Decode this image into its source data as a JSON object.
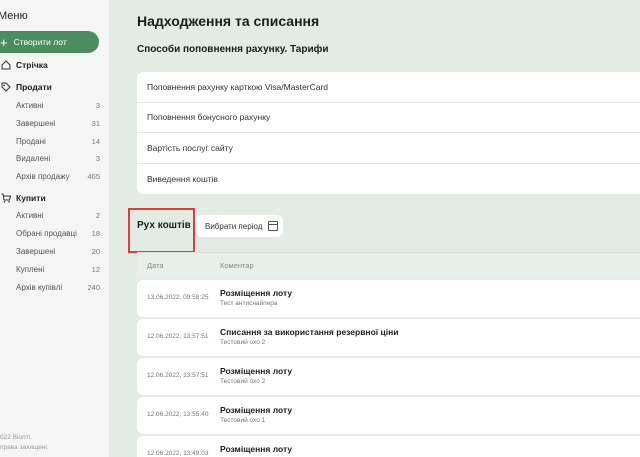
{
  "sidebar": {
    "menu_title": "Меню",
    "create_button": "Створити лот",
    "feed_label": "Стрічка",
    "sell_label": "Продати",
    "sell_items": [
      {
        "label": "Активні",
        "count": "3"
      },
      {
        "label": "Завершені",
        "count": "31"
      },
      {
        "label": "Продані",
        "count": "14"
      },
      {
        "label": "Видалені",
        "count": "3"
      },
      {
        "label": "Архів продажу",
        "count": "465"
      }
    ],
    "buy_label": "Купити",
    "buy_items": [
      {
        "label": "Активні",
        "count": "2"
      },
      {
        "label": "Обрані продавці",
        "count": "18"
      },
      {
        "label": "Завершені",
        "count": "20"
      },
      {
        "label": "Куплені",
        "count": "12"
      },
      {
        "label": "Архів купівлі",
        "count": "240"
      }
    ],
    "copyright_line1": "022 Віолті.",
    "copyright_line2": "права захищені."
  },
  "main": {
    "page_title": "Надходження та списання",
    "methods_title": "Способи поповнення рахунку. Тарифи",
    "links": [
      "Поповнення рахунку карткою Visa/MasterCard",
      "Поповнення бонусного рахунку",
      "Вартість послуг сайту",
      "Виведення коштів"
    ],
    "moves_title": "Рух коштів",
    "period_button": "Вибрати період",
    "table": {
      "col_date": "Дата",
      "col_comment": "Коментар",
      "rows": [
        {
          "date": "13.06.2022, 09:58:25",
          "title": "Розміщення лоту",
          "note": "Тест антиснайпера"
        },
        {
          "date": "12.06.2022, 13:57:51",
          "title": "Списання за використання резервної ціни",
          "note": "Тестовий охо 2"
        },
        {
          "date": "12.06.2022, 13:57:51",
          "title": "Розміщення лоту",
          "note": "Тестовий охо 2"
        },
        {
          "date": "12.06.2022, 13:55:40",
          "title": "Розміщення лоту",
          "note": "Тестовий охо 1"
        },
        {
          "date": "12.06.2022, 13:49:03",
          "title": "Розміщення лоту",
          "note": ""
        }
      ]
    }
  },
  "colors": {
    "accent_green": "#4b8c61",
    "main_bg": "#e3ebe5",
    "highlight_red": "#e23b3b"
  }
}
